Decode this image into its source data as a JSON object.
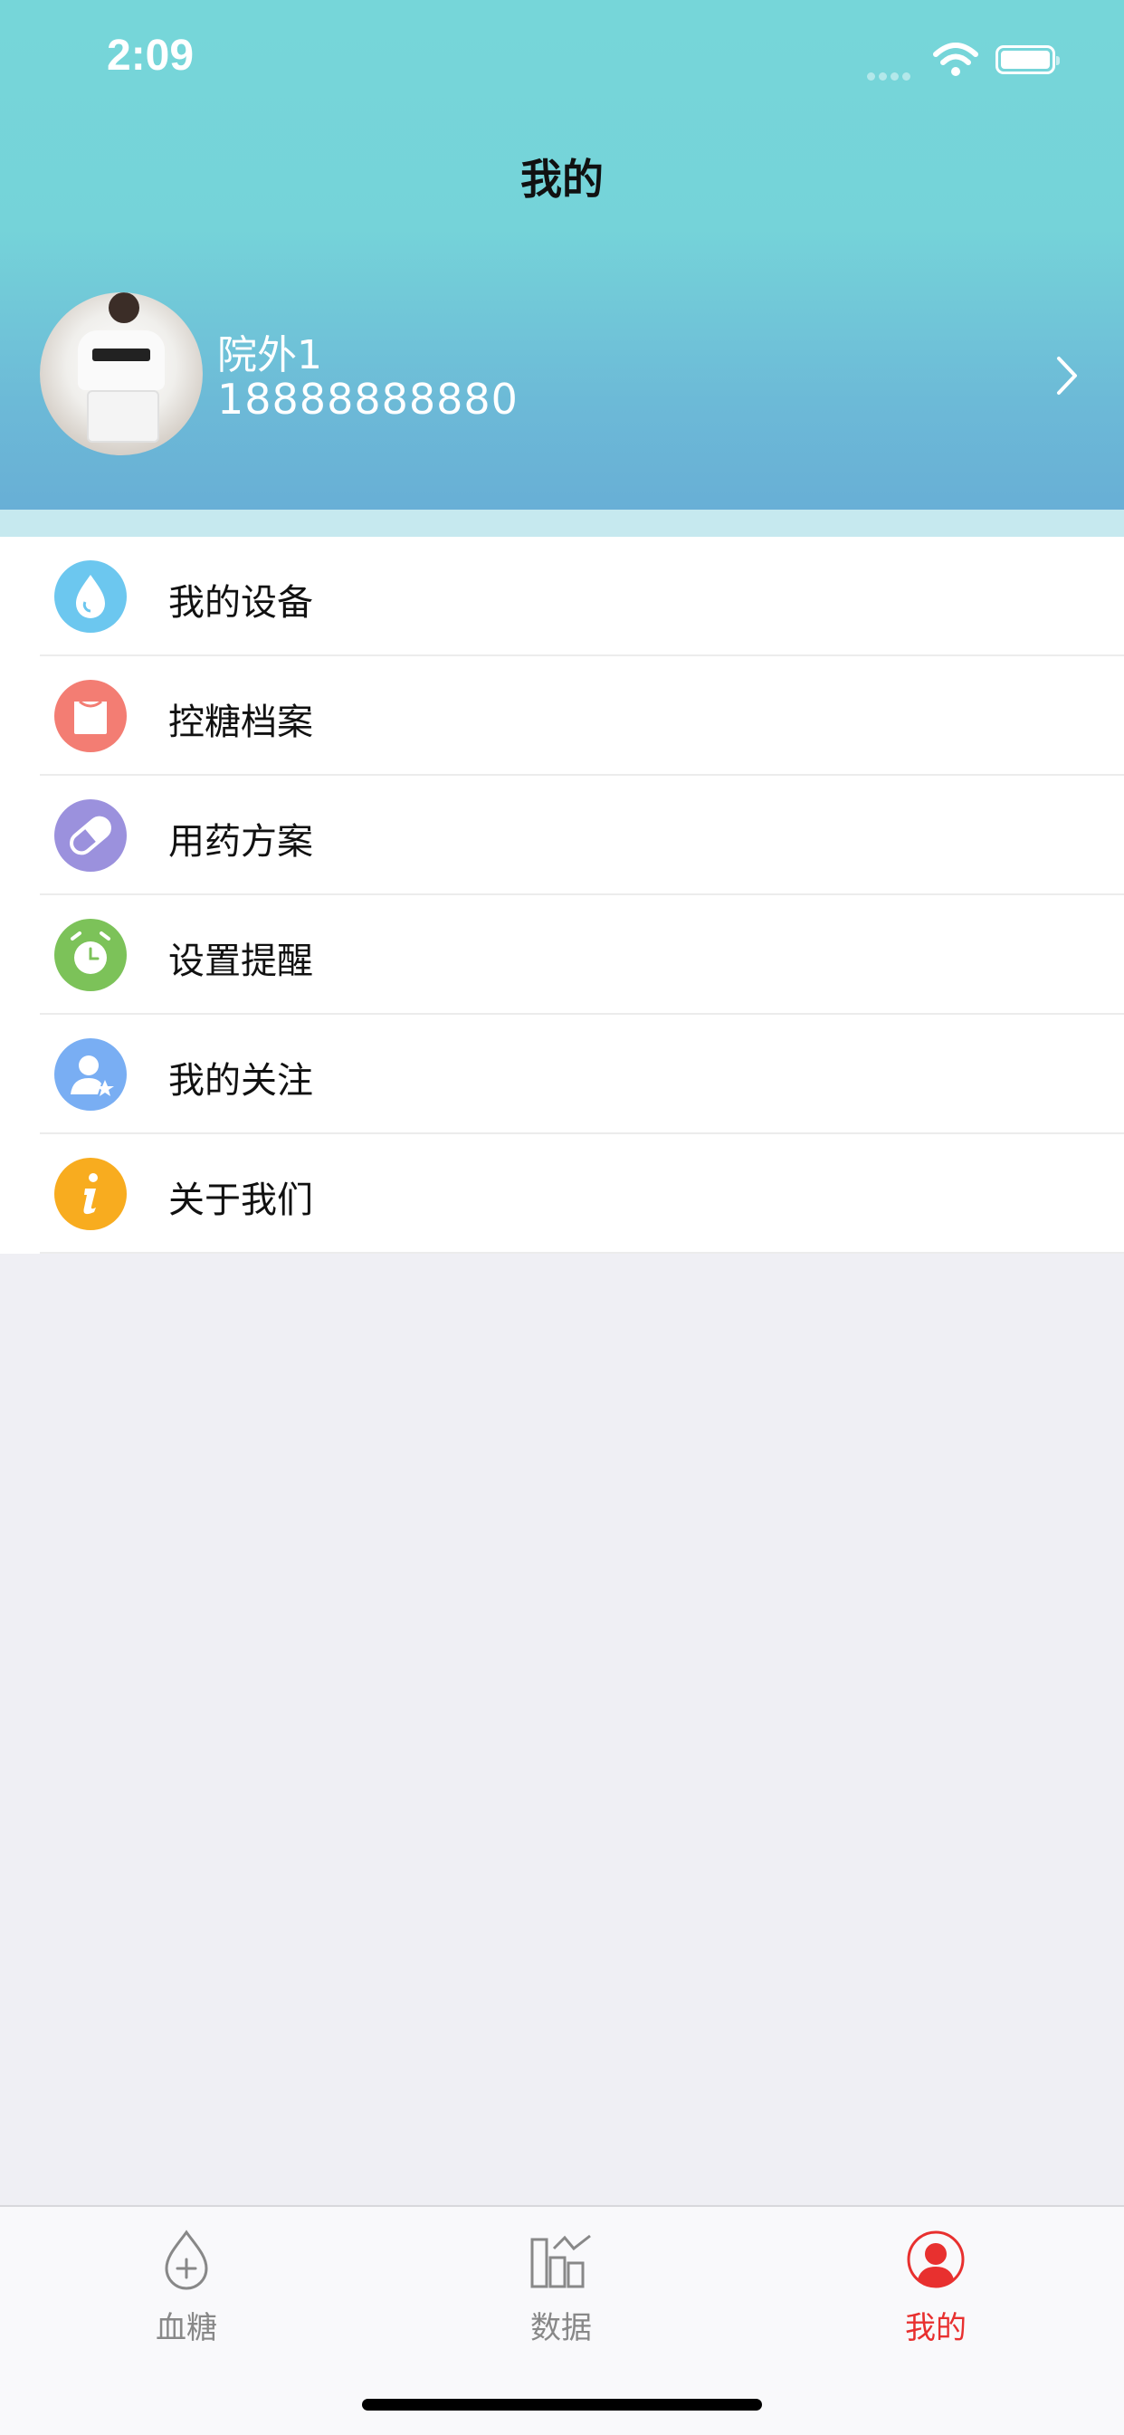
{
  "status_bar": {
    "time": "2:09"
  },
  "header": {
    "title": "我的"
  },
  "profile": {
    "name": "院外1",
    "phone": "18888888880"
  },
  "menu": [
    {
      "label": "我的设备",
      "icon": "water-drop-icon",
      "color": "#6cc7ef"
    },
    {
      "label": "控糖档案",
      "icon": "folder-icon",
      "color": "#f37d73"
    },
    {
      "label": "用药方案",
      "icon": "pill-icon",
      "color": "#9b91dd"
    },
    {
      "label": "设置提醒",
      "icon": "alarm-clock-icon",
      "color": "#7cc259"
    },
    {
      "label": "我的关注",
      "icon": "user-star-icon",
      "color": "#79aef3"
    },
    {
      "label": "关于我们",
      "icon": "info-icon",
      "color": "#f8ac1f"
    }
  ],
  "tabbar": {
    "tabs": [
      {
        "label": "血糖",
        "icon": "drop-plus-icon",
        "active": false
      },
      {
        "label": "数据",
        "icon": "bar-chart-icon",
        "active": false
      },
      {
        "label": "我的",
        "icon": "user-circle-icon",
        "active": true
      }
    ],
    "active_color": "#e8302f",
    "inactive_color": "#888888"
  }
}
